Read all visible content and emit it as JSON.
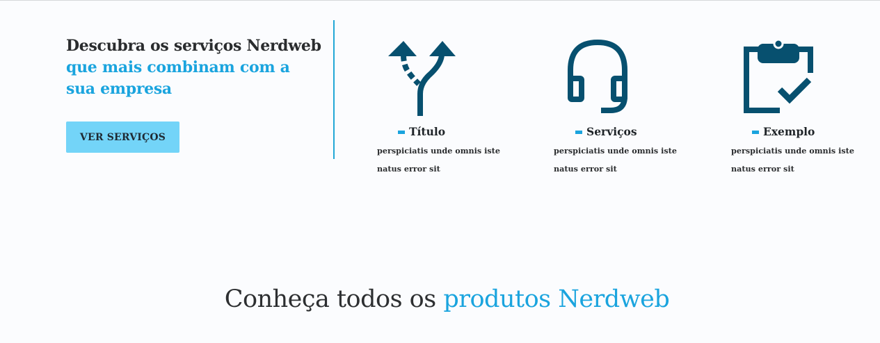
{
  "intro": {
    "heading_line1": "Descubra os serviços Nerdweb",
    "heading_line2": "que mais combinam com a sua empresa",
    "cta_label": "VER SERVIÇOS"
  },
  "services": [
    {
      "icon": "split-arrow-icon",
      "title": "Título",
      "description": "perspiciatis unde omnis iste natus error sit"
    },
    {
      "icon": "headset-icon",
      "title": "Serviços",
      "description": "perspiciatis unde omnis iste natus error sit"
    },
    {
      "icon": "clipboard-check-icon",
      "title": "Exemplo",
      "description": "perspiciatis unde omnis iste natus error sit"
    }
  ],
  "products": {
    "title_prefix": "Conheça todos os",
    "title_accent": "produtos Nerdweb"
  },
  "colors": {
    "accent": "#1aa4de",
    "button_bg": "#73d4f8",
    "icon": "#07506f",
    "divider": "#22a7d6",
    "text_dark": "#2a2c2e"
  }
}
